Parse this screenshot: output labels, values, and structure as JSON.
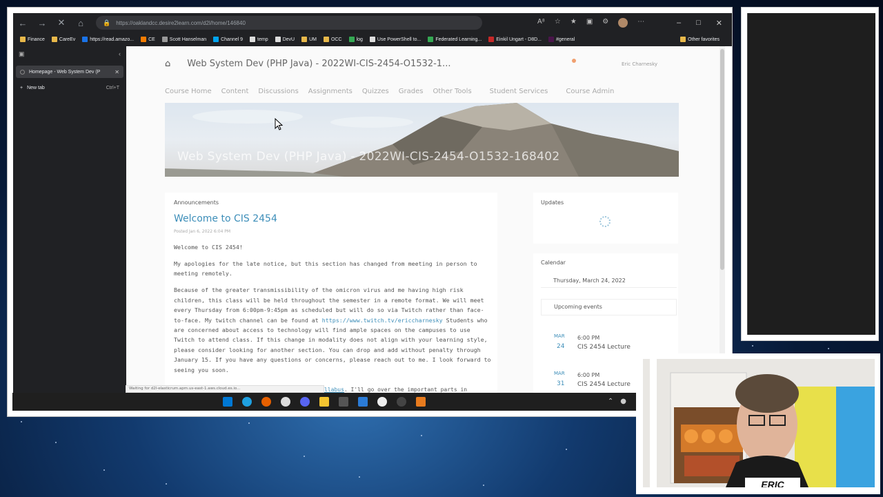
{
  "browser": {
    "url": "https://oaklandcc.desire2learn.com/d2l/home/146840",
    "favorites": [
      "Finance",
      "CareEv",
      "https://read.amazo...",
      "CE",
      "Scott Hanselman",
      "Channel 9",
      "temp",
      "DevU",
      "UM",
      "OCC",
      "log",
      "Use PowerShell to...",
      "Federated Learning...",
      "Einkil Ungart - D8D...",
      "#general"
    ],
    "other_favorites": "Other favorites",
    "tabs": [
      {
        "label": "Homepage - Web System Dev (P"
      }
    ],
    "new_tab_label": "New tab",
    "new_tab_shortcut": "Ctrl+T",
    "status_text": "Waiting for d2l-elasticrum.apm.us-east-1.aws.cloud.es.io..."
  },
  "course": {
    "title": "Web System Dev (PHP Java) - 2022WI-CIS-2454-O1532-1...",
    "user": "Eric Charnesky",
    "nav": [
      "Course Home",
      "Content",
      "Discussions",
      "Assignments",
      "Quizzes",
      "Grades",
      "Other Tools",
      "Student Services",
      "Course Admin"
    ],
    "banner_title": "Web System Dev (PHP Java) - 2022WI-CIS-2454-O1532-168402"
  },
  "announcements": {
    "label": "Announcements",
    "title": "Welcome to CIS 2454",
    "posted": "Posted Jan 6, 2022 6:04 PM",
    "p1": "Welcome to CIS 2454!",
    "p2": "My apologies for the late notice, but this section has changed from meeting in person to meeting remotely.",
    "p3a": "Because of the greater transmissibility of the omicron virus and me having high risk children, this class will be held throughout the semester in a remote format.  We will meet every Thursday from 6:00pm-9:45pm as scheduled but will do so via Twitch rather than face-to-face.  My twitch channel can be found at ",
    "p3_link": "https://www.twitch.tv/ericcharnesky",
    "p3b": " Students who are concerned about access to technology will find ample spaces on the campuses to use Twitch to attend class.  If this change in modality does not align with your learning style, please consider looking for another section. You can drop and add without penalty through January 15.  If you have any questions or concerns, please reach out to me.  I look forward to seeing you soon.",
    "bottom_link": "llabus",
    "bottom_text": ". I'll go over the important parts in"
  },
  "updates": {
    "label": "Updates"
  },
  "calendar": {
    "label": "Calendar",
    "date": "Thursday, March 24, 2022",
    "upcoming_label": "Upcoming events",
    "events": [
      {
        "mon": "MAR",
        "day": "24",
        "time": "6:00 PM",
        "name": "CIS 2454 Lecture"
      },
      {
        "mon": "MAR",
        "day": "31",
        "time": "6:00 PM",
        "name": "CIS 2454 Lecture"
      }
    ]
  },
  "webcam": {
    "label": "ERIC"
  },
  "colors": {
    "link": "#3d8eb9",
    "chrome_dark": "#202124"
  }
}
